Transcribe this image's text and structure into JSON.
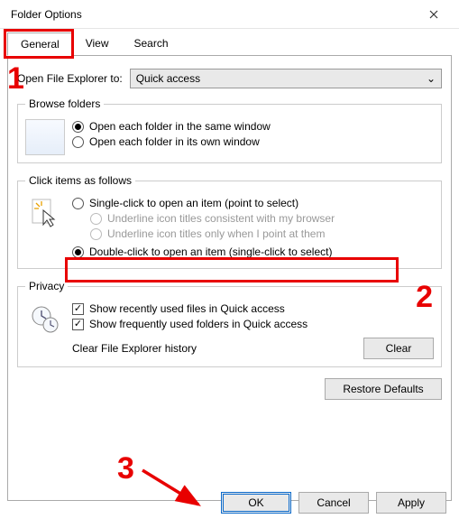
{
  "window": {
    "title": "Folder Options"
  },
  "tabs": {
    "general": "General",
    "view": "View",
    "search": "Search"
  },
  "open_explorer": {
    "label": "Open File Explorer to:",
    "value": "Quick access"
  },
  "browse": {
    "legend": "Browse folders",
    "opt_same": "Open each folder in the same window",
    "opt_own": "Open each folder in its own window"
  },
  "click": {
    "legend": "Click items as follows",
    "single": "Single-click to open an item (point to select)",
    "underline_browser": "Underline icon titles consistent with my browser",
    "underline_point": "Underline icon titles only when I point at them",
    "double": "Double-click to open an item (single-click to select)"
  },
  "privacy": {
    "legend": "Privacy",
    "recent_files": "Show recently used files in Quick access",
    "freq_folders": "Show frequently used folders in Quick access",
    "clear_label": "Clear File Explorer history",
    "clear_btn": "Clear"
  },
  "restore": "Restore Defaults",
  "buttons": {
    "ok": "OK",
    "cancel": "Cancel",
    "apply": "Apply"
  },
  "annotations": {
    "n1": "1",
    "n2": "2",
    "n3": "3"
  }
}
